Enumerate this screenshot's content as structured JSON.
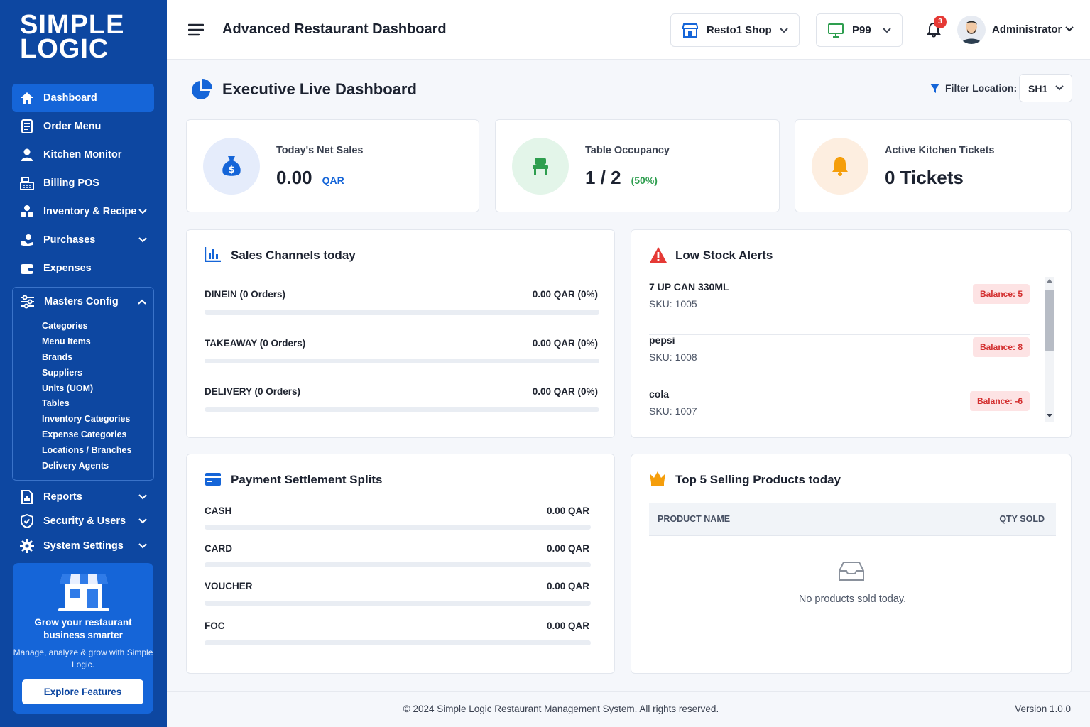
{
  "brand": {
    "logo_line1": "SIMPLE",
    "logo_line2": "LOGIC"
  },
  "sidebar": {
    "items": [
      {
        "label": "Dashboard",
        "icon": "home-icon"
      },
      {
        "label": "Order Menu",
        "icon": "order-icon"
      },
      {
        "label": "Kitchen Monitor",
        "icon": "chef-icon"
      },
      {
        "label": "Billing POS",
        "icon": "cash-register-icon"
      },
      {
        "label": "Inventory & Recipe",
        "icon": "boxes-icon"
      },
      {
        "label": "Purchases",
        "icon": "purchase-icon"
      },
      {
        "label": "Expenses",
        "icon": "wallet-icon"
      }
    ],
    "masters": {
      "label": "Masters Config",
      "sub": [
        "Categories",
        "Menu Items",
        "Brands",
        "Suppliers",
        "Units (UOM)",
        "Tables",
        "Inventory Categories",
        "Expense Categories",
        "Locations / Branches",
        "Delivery Agents"
      ]
    },
    "bottom_items": [
      {
        "label": "Reports",
        "icon": "report-icon"
      },
      {
        "label": "Security & Users",
        "icon": "shield-icon"
      },
      {
        "label": "System Settings",
        "icon": "gear-icon"
      }
    ],
    "promo": {
      "title": "Grow your restaurant business smarter",
      "subtitle": "Manage, analyze & grow with Simple Logic.",
      "button": "Explore Features"
    }
  },
  "header": {
    "title": "Advanced Restaurant Dashboard",
    "shop": "Resto1 Shop",
    "terminal": "P99",
    "notifications": "3",
    "user": "Administrator"
  },
  "page": {
    "title": "Executive Live Dashboard",
    "filter_label": "Filter Location:",
    "filter_value": "SH1"
  },
  "stats": {
    "sales": {
      "label": "Today's Net Sales",
      "value": "0.00",
      "unit": "QAR"
    },
    "tables": {
      "label": "Table Occupancy",
      "value": "1 / 2",
      "unit": "(50%)"
    },
    "kitchen": {
      "label": "Active Kitchen Tickets",
      "value": "0 Tickets"
    }
  },
  "channels": {
    "title": "Sales Channels today",
    "rows": [
      {
        "label": "DINEIN (0 Orders)",
        "value": "0.00 QAR (0%)",
        "percent": 0
      },
      {
        "label": "TAKEAWAY (0 Orders)",
        "value": "0.00 QAR (0%)",
        "percent": 0
      },
      {
        "label": "DELIVERY (0 Orders)",
        "value": "0.00 QAR (0%)",
        "percent": 0
      }
    ]
  },
  "low_stock": {
    "title": "Low Stock Alerts",
    "items": [
      {
        "name": "7 UP CAN 330ML",
        "sku": "SKU: 1005",
        "balance": "Balance: 5"
      },
      {
        "name": "pepsi",
        "sku": "SKU: 1008",
        "balance": "Balance: 8"
      },
      {
        "name": "cola",
        "sku": "SKU: 1007",
        "balance": "Balance: -6"
      }
    ]
  },
  "payments": {
    "title": "Payment Settlement Splits",
    "rows": [
      {
        "label": "CASH",
        "value": "0.00 QAR",
        "percent": 0
      },
      {
        "label": "CARD",
        "value": "0.00 QAR",
        "percent": 0
      },
      {
        "label": "VOUCHER",
        "value": "0.00 QAR",
        "percent": 0
      },
      {
        "label": "FOC",
        "value": "0.00 QAR",
        "percent": 0
      }
    ]
  },
  "top_products": {
    "title": "Top 5 Selling Products today",
    "col_name": "PRODUCT NAME",
    "col_qty": "QTY SOLD",
    "empty": "No products sold today."
  },
  "footer": {
    "copyright": "© 2024 Simple Logic Restaurant Management System. All rights reserved.",
    "version": "Version 1.0.0"
  },
  "colors": {
    "primary": "#0d47a1",
    "accent": "#1565d8",
    "danger": "#e53935",
    "success": "#2e9e4f",
    "warning": "#f59e0b"
  }
}
